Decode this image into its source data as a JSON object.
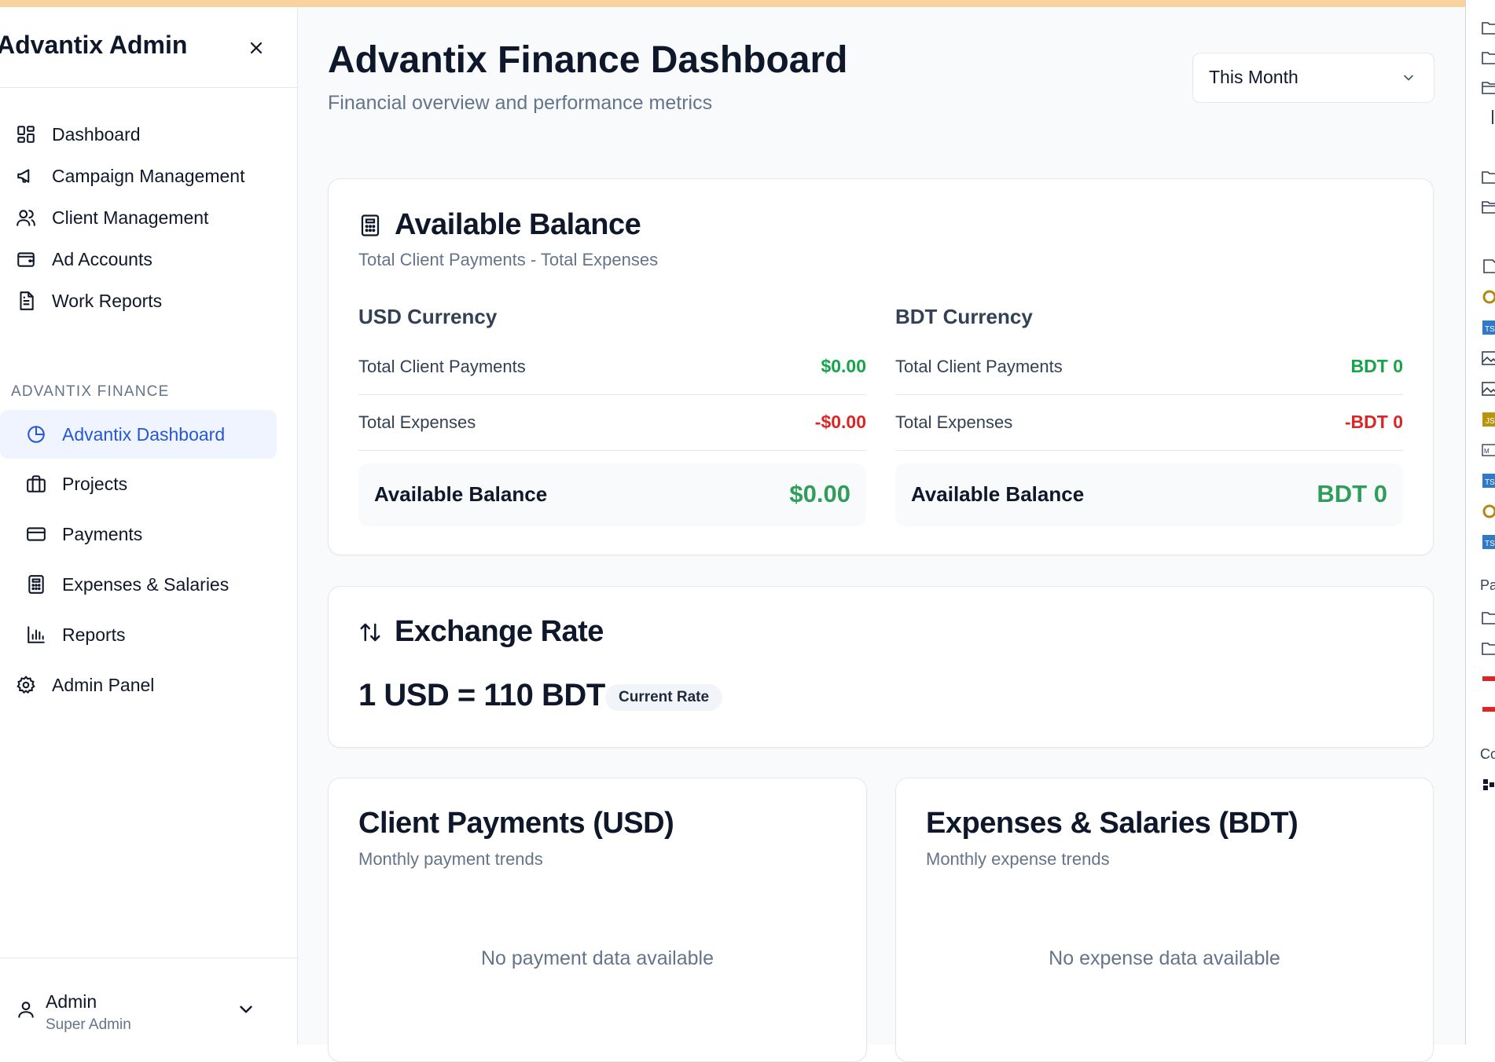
{
  "colors": {
    "accent": "#2557d6",
    "active_bg": "#eff4ff",
    "positive": "#16a34a",
    "negative": "#dc2626",
    "balance": "#2f9e5a",
    "top_bar": "#f8d39e"
  },
  "sidebar": {
    "brand": "Advantix Admin",
    "close_icon": "close-icon",
    "nav": [
      {
        "label": "Dashboard",
        "icon": "grid-icon"
      },
      {
        "label": "Campaign Management",
        "icon": "megaphone-icon"
      },
      {
        "label": "Client Management",
        "icon": "users-icon"
      },
      {
        "label": "Ad Accounts",
        "icon": "wallet-icon"
      },
      {
        "label": "Work Reports",
        "icon": "file-text-icon"
      }
    ],
    "section_title": "ADVANTIX FINANCE",
    "finance_nav": [
      {
        "label": "Advantix Dashboard",
        "icon": "pie-chart-icon",
        "active": true
      },
      {
        "label": "Projects",
        "icon": "briefcase-icon"
      },
      {
        "label": "Payments",
        "icon": "credit-card-icon"
      },
      {
        "label": "Expenses & Salaries",
        "icon": "calculator-icon"
      },
      {
        "label": "Reports",
        "icon": "bar-chart-icon"
      }
    ],
    "admin_panel": {
      "label": "Admin Panel",
      "icon": "gear-icon"
    },
    "user": {
      "name": "Admin",
      "role": "Super Admin"
    }
  },
  "header": {
    "title": "Advantix Finance Dashboard",
    "subtitle": "Financial overview and performance metrics",
    "period_select": "This Month"
  },
  "balance_card": {
    "title": "Available Balance",
    "subtitle": "Total Client Payments - Total Expenses",
    "usd": {
      "title": "USD Currency",
      "payments_label": "Total Client Payments",
      "payments_value": "$0.00",
      "expenses_label": "Total Expenses",
      "expenses_value": "-$0.00",
      "balance_label": "Available Balance",
      "balance_value": "$0.00"
    },
    "bdt": {
      "title": "BDT Currency",
      "payments_label": "Total Client Payments",
      "payments_value": "BDT 0",
      "expenses_label": "Total Expenses",
      "expenses_value": "-BDT 0",
      "balance_label": "Available Balance",
      "balance_value": "BDT 0"
    }
  },
  "exchange_card": {
    "title": "Exchange Rate",
    "rate": "1 USD = 110 BDT",
    "badge": "Current Rate"
  },
  "payments_chart_card": {
    "title": "Client Payments (USD)",
    "subtitle": "Monthly payment trends",
    "empty": "No payment data available"
  },
  "expenses_chart_card": {
    "title": "Expenses & Salaries (BDT)",
    "subtitle": "Monthly expense trends",
    "empty": "No expense data available"
  },
  "right_strip": {
    "section_a": "Pa",
    "section_b": "Co",
    "icons": [
      "folder-icon",
      "folder-icon",
      "folder-open-icon",
      "folder-icon",
      "folder-icon",
      "file-icon",
      "settings-file-icon",
      "ts-file-icon",
      "image-file-icon",
      "image-file-icon",
      "js-file-icon",
      "md-file-icon",
      "ts-file-icon",
      "settings-file-icon",
      "ts-file-icon",
      "folder-icon",
      "folder-icon",
      "pdf-file-icon",
      "pdf-file-icon",
      "qr-icon"
    ]
  }
}
